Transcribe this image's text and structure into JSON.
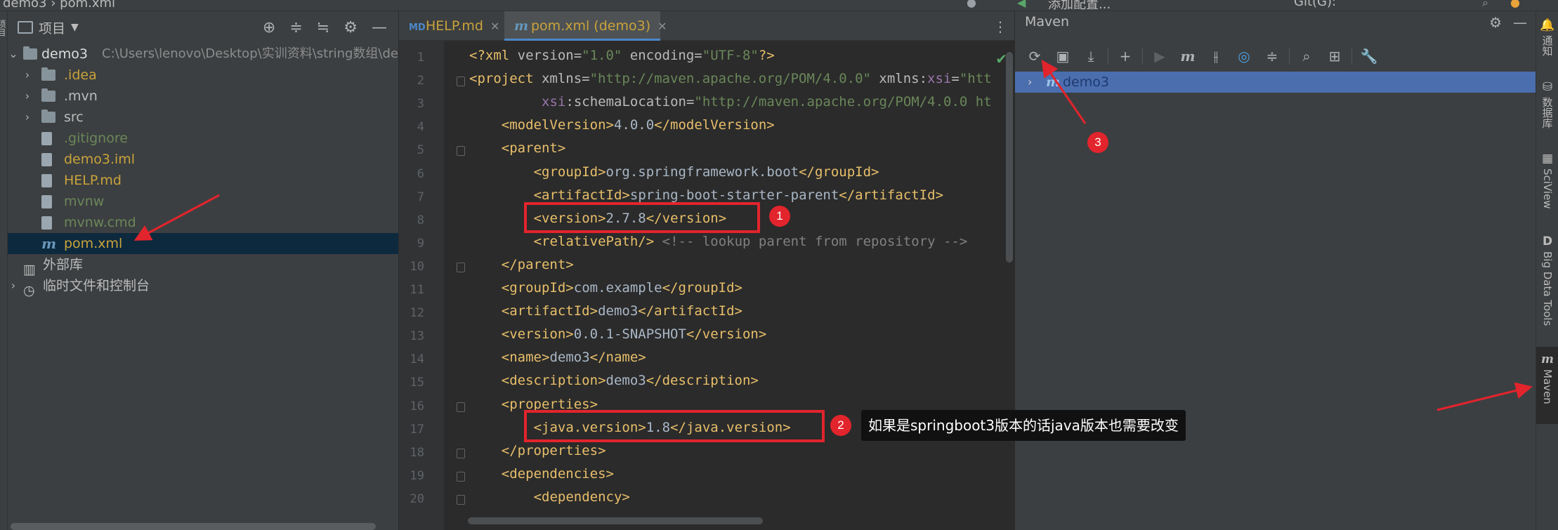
{
  "topbar": {
    "breadcrumb_project": "demo3",
    "breadcrumb_file": "pom.xml",
    "run_config": "添加配置...",
    "vcs_label": "Git(G):"
  },
  "left_strip": {
    "tab_label": "项目"
  },
  "project_panel": {
    "title": "项目",
    "root": {
      "name": "demo3",
      "path": "C:\\Users\\lenovo\\Desktop\\实训资料\\string数组\\dem"
    },
    "items": [
      {
        "label": ".idea",
        "type": "folder",
        "color": "#c9a33b"
      },
      {
        "label": ".mvn",
        "type": "folder",
        "color": "#bbbbbb"
      },
      {
        "label": "src",
        "type": "folder",
        "color": "#bbbbbb"
      },
      {
        "label": ".gitignore",
        "type": "file",
        "color": "#6a8759"
      },
      {
        "label": "demo3.iml",
        "type": "file",
        "color": "#c9a33b"
      },
      {
        "label": "HELP.md",
        "type": "file",
        "color": "#c9a33b"
      },
      {
        "label": "mvnw",
        "type": "file",
        "color": "#6a8759"
      },
      {
        "label": "mvnw.cmd",
        "type": "file",
        "color": "#6a8759"
      },
      {
        "label": "pom.xml",
        "type": "maven",
        "color": "#c9a33b"
      }
    ],
    "external_libs": "外部库",
    "scratches": "临时文件和控制台"
  },
  "editor": {
    "tabs": [
      {
        "label": "HELP.md",
        "icon": "md-file-icon"
      },
      {
        "label": "pom.xml (demo3)",
        "icon": "maven-icon"
      }
    ],
    "lines": [
      {
        "n": "1",
        "ind": 0,
        "html_parts": [
          [
            "t",
            "<?xml "
          ],
          [
            "a",
            "version="
          ],
          [
            "v",
            "\"1.0\""
          ],
          [
            "a",
            " encoding="
          ],
          [
            "v",
            "\"UTF-8\""
          ],
          [
            "t",
            "?>"
          ]
        ]
      },
      {
        "n": "2",
        "ind": 0,
        "html_parts": [
          [
            "t",
            "<project "
          ],
          [
            "a",
            "xmlns="
          ],
          [
            "v",
            "\"http://maven.apache.org/POM/4.0.0\""
          ],
          [
            "a",
            " xmlns:"
          ],
          [
            "n",
            "xsi"
          ],
          [
            "a",
            "="
          ],
          [
            "v",
            "\"htt"
          ]
        ]
      },
      {
        "n": "3",
        "ind": 9,
        "html_parts": [
          [
            "n",
            "xsi"
          ],
          [
            "a",
            ":schemaLocation="
          ],
          [
            "v",
            "\"http://maven.apache.org/POM/4.0.0 ht"
          ]
        ]
      },
      {
        "n": "4",
        "ind": 4,
        "html_parts": [
          [
            "t",
            "<modelVersion>"
          ],
          [
            "x",
            "4.0.0"
          ],
          [
            "t",
            "</modelVersion>"
          ]
        ]
      },
      {
        "n": "5",
        "ind": 4,
        "html_parts": [
          [
            "t",
            "<parent>"
          ]
        ]
      },
      {
        "n": "6",
        "ind": 8,
        "html_parts": [
          [
            "t",
            "<groupId>"
          ],
          [
            "x",
            "org.springframework.boot"
          ],
          [
            "t",
            "</groupId>"
          ]
        ]
      },
      {
        "n": "7",
        "ind": 8,
        "html_parts": [
          [
            "t",
            "<artifactId>"
          ],
          [
            "x",
            "spring-boot-starter-parent"
          ],
          [
            "t",
            "</artifactId>"
          ]
        ]
      },
      {
        "n": "8",
        "ind": 8,
        "html_parts": [
          [
            "t",
            "<version>"
          ],
          [
            "x",
            "2.7.8"
          ],
          [
            "t",
            "</version>"
          ]
        ]
      },
      {
        "n": "9",
        "ind": 8,
        "html_parts": [
          [
            "t",
            "<relativePath/>"
          ],
          [
            "c",
            " <!-- lookup parent from repository -->"
          ]
        ]
      },
      {
        "n": "10",
        "ind": 4,
        "html_parts": [
          [
            "t",
            "</parent>"
          ]
        ]
      },
      {
        "n": "11",
        "ind": 4,
        "html_parts": [
          [
            "t",
            "<groupId>"
          ],
          [
            "x",
            "com.example"
          ],
          [
            "t",
            "</groupId>"
          ]
        ]
      },
      {
        "n": "12",
        "ind": 4,
        "html_parts": [
          [
            "t",
            "<artifactId>"
          ],
          [
            "x",
            "demo3"
          ],
          [
            "t",
            "</artifactId>"
          ]
        ]
      },
      {
        "n": "13",
        "ind": 4,
        "html_parts": [
          [
            "t",
            "<version>"
          ],
          [
            "x",
            "0.0.1-SNAPSHOT"
          ],
          [
            "t",
            "</version>"
          ]
        ]
      },
      {
        "n": "14",
        "ind": 4,
        "html_parts": [
          [
            "t",
            "<name>"
          ],
          [
            "x",
            "demo3"
          ],
          [
            "t",
            "</name>"
          ]
        ]
      },
      {
        "n": "15",
        "ind": 4,
        "html_parts": [
          [
            "t",
            "<description>"
          ],
          [
            "x",
            "demo3"
          ],
          [
            "t",
            "</description>"
          ]
        ]
      },
      {
        "n": "16",
        "ind": 4,
        "html_parts": [
          [
            "t",
            "<properties>"
          ]
        ]
      },
      {
        "n": "17",
        "ind": 8,
        "html_parts": [
          [
            "t",
            "<java.version>"
          ],
          [
            "x",
            "1.8"
          ],
          [
            "t",
            "</java.version>"
          ]
        ]
      },
      {
        "n": "18",
        "ind": 4,
        "html_parts": [
          [
            "t",
            "</properties>"
          ]
        ]
      },
      {
        "n": "19",
        "ind": 4,
        "html_parts": [
          [
            "t",
            "<dependencies>"
          ]
        ]
      },
      {
        "n": "20",
        "ind": 8,
        "html_parts": [
          [
            "t",
            "<dependency>"
          ]
        ]
      }
    ]
  },
  "maven": {
    "title": "Maven",
    "tree_root": "demo3",
    "toolbar": [
      "reload-icon",
      "add-folder-icon",
      "download-icon",
      "plus-icon",
      "run-icon",
      "maven-goal-icon",
      "toggle-offline-icon",
      "skip-tests-icon",
      "collapse-icon",
      "analyze-icon",
      "show-deps-icon",
      "wrench-icon"
    ]
  },
  "right_strip": {
    "tabs": [
      {
        "label": "通知",
        "icon": "bell-icon"
      },
      {
        "label": "数据库",
        "icon": "database-icon"
      },
      {
        "label": "SciView",
        "icon": "sciview-icon"
      },
      {
        "label": "Big Data Tools",
        "icon": "bigdata-icon"
      },
      {
        "label": "Maven",
        "icon": "maven-icon"
      }
    ]
  },
  "annotations": {
    "badge1": "1",
    "badge2": "2",
    "badge3": "3",
    "tooltip": "如果是springboot3版本的话java版本也需要改变",
    "color": "#e2242c"
  }
}
